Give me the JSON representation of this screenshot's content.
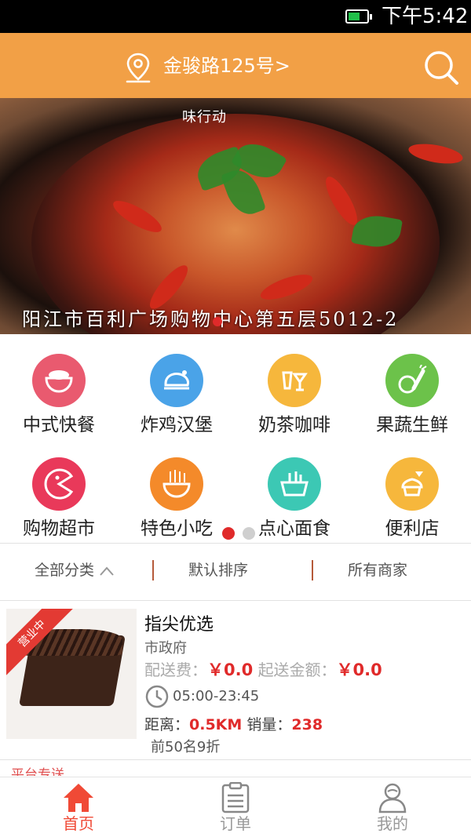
{
  "status_bar": {
    "time": "下午5:42",
    "battery": "charging"
  },
  "header": {
    "address": "金骏路125号>",
    "location_icon": "location-pin-icon",
    "search_icon": "search-icon"
  },
  "banner": {
    "brand": "味行动",
    "caption": "阳江市百利广场购物中心第五层5012-2",
    "active_slide": 1
  },
  "categories": [
    {
      "label": "中式快餐",
      "icon": "rice-bowl-icon",
      "color": "#e95a6f"
    },
    {
      "label": "炸鸡汉堡",
      "icon": "roast-chicken-icon",
      "color": "#4aa3e8"
    },
    {
      "label": "奶茶咖啡",
      "icon": "drinks-icon",
      "color": "#f6b73c"
    },
    {
      "label": "果蔬生鲜",
      "icon": "fruit-vegetable-icon",
      "color": "#6cc24a"
    },
    {
      "label": "购物超市",
      "icon": "pacman-icon",
      "color": "#e9395a"
    },
    {
      "label": "特色小吃",
      "icon": "noodle-bowl-icon",
      "color": "#f48a2a"
    },
    {
      "label": "点心面食",
      "icon": "basket-icon",
      "color": "#3cc8b4"
    },
    {
      "label": "便利店",
      "icon": "dessert-icon",
      "color": "#f6b73c"
    }
  ],
  "category_pages": {
    "count": 2,
    "active": 1
  },
  "filters": {
    "all_categories": "全部分类",
    "default_sort": "默认排序",
    "all_shops": "所有商家"
  },
  "shop": {
    "status_ribbon": "营业中",
    "name": "指尖优选",
    "area": "市政府",
    "delivery_fee_label": "配送费：",
    "delivery_fee": "￥0.0",
    "min_order_label": "起送金额：",
    "min_order": "￥0.0",
    "hours": "05:00-23:45",
    "distance_label": "距离：",
    "distance": "0.5KM",
    "sales_label": "销量：",
    "sales": "238",
    "promo": "前50名9折",
    "platform_delivery": "平台专送"
  },
  "bottom_nav": [
    {
      "label": "首页",
      "icon": "home-icon",
      "active": true
    },
    {
      "label": "订单",
      "icon": "order-list-icon",
      "active": false
    },
    {
      "label": "我的",
      "icon": "profile-icon",
      "active": false
    }
  ],
  "colors": {
    "accent": "#f2a046",
    "active_nav": "#f04a36",
    "price_red": "#e02a2a"
  }
}
